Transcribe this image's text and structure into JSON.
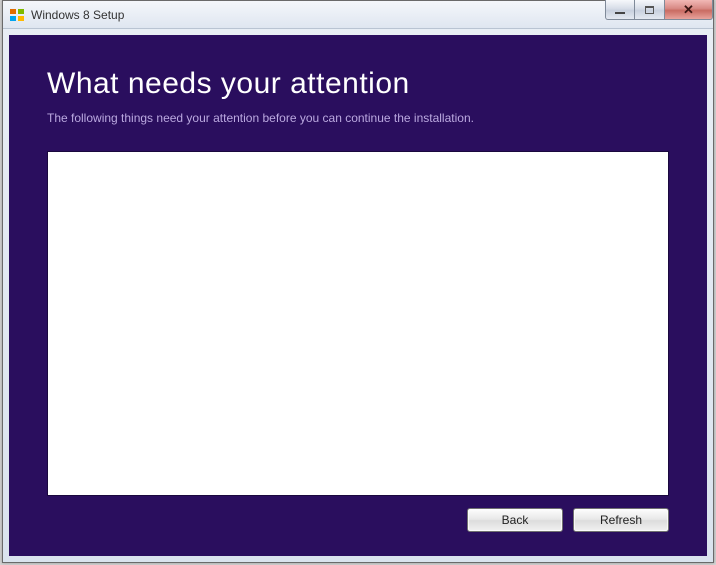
{
  "window": {
    "title": "Windows 8 Setup"
  },
  "main": {
    "heading": "What needs your attention",
    "subheading": "The following things need your attention before you can continue the installation."
  },
  "buttons": {
    "back": "Back",
    "refresh": "Refresh"
  }
}
